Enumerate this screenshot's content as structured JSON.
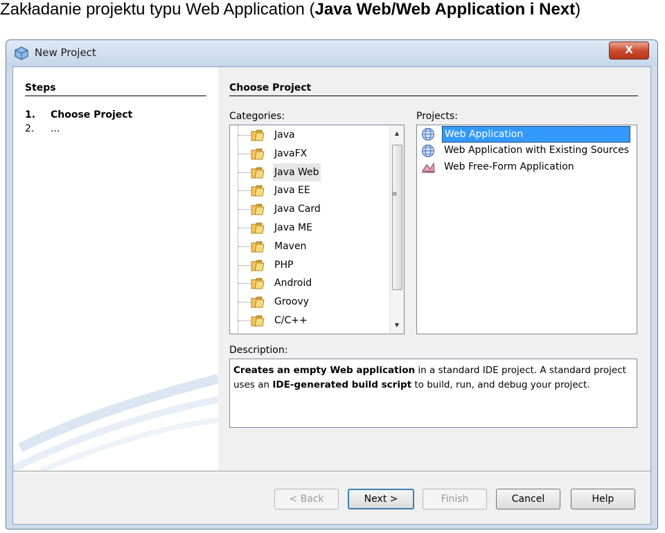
{
  "slide": {
    "title_prefix": "Zakładanie projektu typu Web Application (",
    "title_bold": "Java Web/Web Application i Next",
    "title_suffix": ")"
  },
  "window": {
    "title": "New Project",
    "close_label": "X"
  },
  "steps": {
    "header": "Steps",
    "items": [
      {
        "num": "1.",
        "label": "Choose Project",
        "active": true
      },
      {
        "num": "2.",
        "label": "...",
        "active": false
      }
    ]
  },
  "main": {
    "header": "Choose Project",
    "categories_label": "Categories:",
    "projects_label": "Projects:",
    "description_label": "Description:"
  },
  "categories": [
    {
      "label": "Java"
    },
    {
      "label": "JavaFX"
    },
    {
      "label": "Java Web",
      "selected": true
    },
    {
      "label": "Java EE"
    },
    {
      "label": "Java Card"
    },
    {
      "label": "Java ME"
    },
    {
      "label": "Maven"
    },
    {
      "label": "PHP"
    },
    {
      "label": "Android"
    },
    {
      "label": "Groovy"
    },
    {
      "label": "C/C++"
    }
  ],
  "projects": [
    {
      "label": "Web Application",
      "icon": "globe-icon",
      "selected": true
    },
    {
      "label": "Web Application with Existing Sources",
      "icon": "globe-icon"
    },
    {
      "label": "Web Free-Form Application",
      "icon": "free-form-icon"
    }
  ],
  "description": {
    "part1_bold": "Creates an empty Web application",
    "part2": " in a standard IDE project. A standard project uses an ",
    "part3_bold": "IDE-generated build script",
    "part4": " to build, run, and debug your project."
  },
  "buttons": {
    "back": "< Back",
    "next": "Next >",
    "finish": "Finish",
    "cancel": "Cancel",
    "help": "Help"
  },
  "colors": {
    "selection": "#3399ff",
    "dialog_frame": "#cfdcea",
    "close_button": "#c8472a"
  }
}
